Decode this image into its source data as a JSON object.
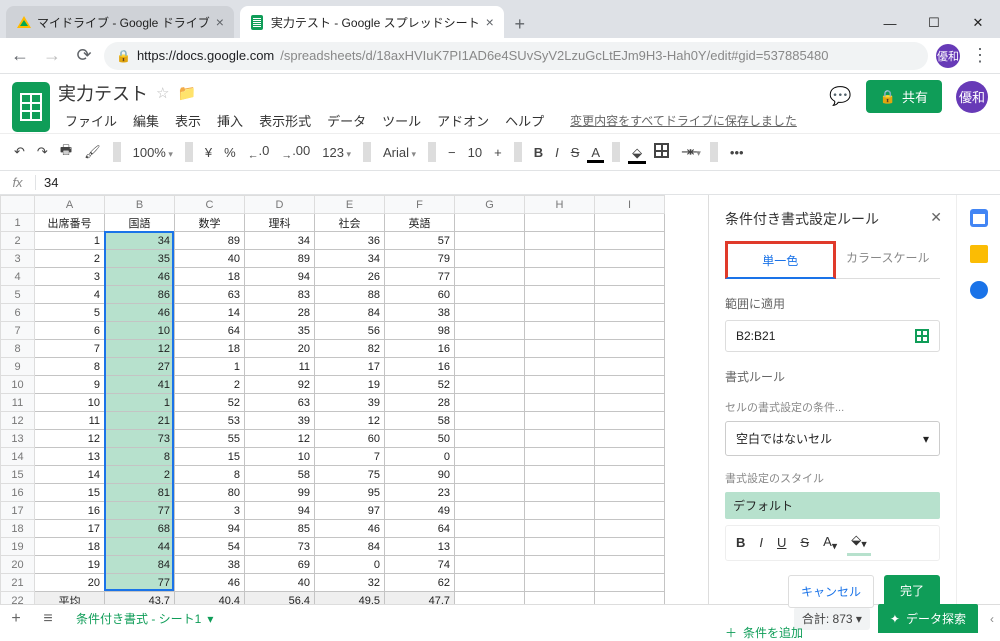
{
  "browser": {
    "tabs": [
      {
        "title": "マイドライブ - Google ドライブ"
      },
      {
        "title": "実力テスト - Google スプレッドシート"
      }
    ],
    "url_host": "https://docs.google.com",
    "url_path": "/spreadsheets/d/18axHVIuK7PI1AD6e4SUvSyV2LzuGcLtEJm9H3-Hah0Y/edit#gid=537885480",
    "profile_initial": "優和"
  },
  "doc": {
    "title": "実力テスト",
    "menus": [
      "ファイル",
      "編集",
      "表示",
      "挿入",
      "表示形式",
      "データ",
      "ツール",
      "アドオン",
      "ヘルプ"
    ],
    "save_msg": "変更内容をすべてドライブに保存しました",
    "share": "共有"
  },
  "toolbar": {
    "zoom": "100%",
    "currency": "¥",
    "percent": "%",
    "dec0": ".0",
    "dec00": ".00",
    "fmt": "123",
    "font": "Arial",
    "size": "10",
    "bold": "B",
    "italic": "I",
    "strike": "S",
    "color": "A",
    "more": "•••"
  },
  "formula": {
    "fx": "fx",
    "value": "34"
  },
  "sheet": {
    "cols": [
      "A",
      "B",
      "C",
      "D",
      "E",
      "F",
      "G",
      "H",
      "I"
    ],
    "headers": [
      "出席番号",
      "国語",
      "数学",
      "理科",
      "社会",
      "英語"
    ],
    "rows": [
      [
        1,
        34,
        89,
        34,
        36,
        57
      ],
      [
        2,
        35,
        40,
        89,
        34,
        79
      ],
      [
        3,
        46,
        18,
        94,
        26,
        77
      ],
      [
        4,
        86,
        63,
        83,
        88,
        60
      ],
      [
        5,
        46,
        14,
        28,
        84,
        38
      ],
      [
        6,
        10,
        64,
        35,
        56,
        98
      ],
      [
        7,
        12,
        18,
        20,
        82,
        16
      ],
      [
        8,
        27,
        1,
        11,
        17,
        16
      ],
      [
        9,
        41,
        2,
        92,
        19,
        52
      ],
      [
        10,
        1,
        52,
        63,
        39,
        28
      ],
      [
        11,
        21,
        53,
        39,
        12,
        58
      ],
      [
        12,
        73,
        55,
        12,
        60,
        50
      ],
      [
        13,
        8,
        15,
        10,
        7,
        0
      ],
      [
        14,
        2,
        8,
        58,
        75,
        90
      ],
      [
        15,
        81,
        80,
        99,
        95,
        23
      ],
      [
        16,
        77,
        3,
        94,
        97,
        49
      ],
      [
        17,
        68,
        94,
        85,
        46,
        64
      ],
      [
        18,
        44,
        54,
        73,
        84,
        13
      ],
      [
        19,
        84,
        38,
        69,
        0,
        74
      ],
      [
        20,
        77,
        46,
        40,
        32,
        62
      ]
    ],
    "avg_label": "平均",
    "avg": [
      43.7,
      40.4,
      56.4,
      49.5,
      47.7
    ]
  },
  "cf": {
    "title": "条件付き書式設定ルール",
    "tab_single": "単一色",
    "tab_scale": "カラースケール",
    "apply_to": "範囲に適用",
    "range": "B2:B21",
    "rule_title": "書式ルール",
    "cond_label": "セルの書式設定の条件...",
    "cond_value": "空白ではないセル",
    "style_label": "書式設定のスタイル",
    "style_preview": "デフォルト",
    "cancel": "キャンセル",
    "done": "完了",
    "add": "条件を追加"
  },
  "footer": {
    "sheet_name": "条件付き書式 - シート1",
    "sum": "合計: 873",
    "explore": "データ探索"
  },
  "chart_data": {
    "type": "table",
    "title": "実力テスト",
    "columns": [
      "出席番号",
      "国語",
      "数学",
      "理科",
      "社会",
      "英語"
    ],
    "rows": [
      [
        1,
        34,
        89,
        34,
        36,
        57
      ],
      [
        2,
        35,
        40,
        89,
        34,
        79
      ],
      [
        3,
        46,
        18,
        94,
        26,
        77
      ],
      [
        4,
        86,
        63,
        83,
        88,
        60
      ],
      [
        5,
        46,
        14,
        28,
        84,
        38
      ],
      [
        6,
        10,
        64,
        35,
        56,
        98
      ],
      [
        7,
        12,
        18,
        20,
        82,
        16
      ],
      [
        8,
        27,
        1,
        11,
        17,
        16
      ],
      [
        9,
        41,
        2,
        92,
        19,
        52
      ],
      [
        10,
        1,
        52,
        63,
        39,
        28
      ],
      [
        11,
        21,
        53,
        39,
        12,
        58
      ],
      [
        12,
        73,
        55,
        12,
        60,
        50
      ],
      [
        13,
        8,
        15,
        10,
        7,
        0
      ],
      [
        14,
        2,
        8,
        58,
        75,
        90
      ],
      [
        15,
        81,
        80,
        99,
        95,
        23
      ],
      [
        16,
        77,
        3,
        94,
        97,
        49
      ],
      [
        17,
        68,
        94,
        85,
        46,
        64
      ],
      [
        18,
        44,
        54,
        73,
        84,
        13
      ],
      [
        19,
        84,
        38,
        69,
        0,
        74
      ],
      [
        20,
        77,
        46,
        40,
        32,
        62
      ]
    ],
    "summary": {
      "label": "平均",
      "values": [
        43.7,
        40.4,
        56.4,
        49.5,
        47.7
      ]
    }
  }
}
